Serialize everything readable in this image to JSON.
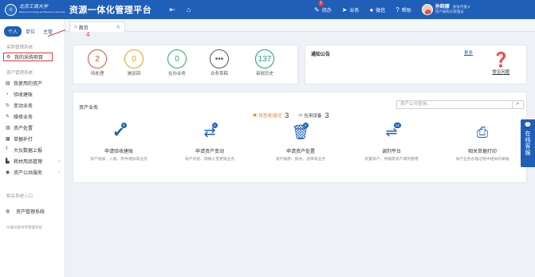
{
  "header": {
    "logo_cn": "北京工商大学",
    "logo_en": "Beijing Technology and Business University",
    "app_title": "资源一体化管理平台",
    "todo_label": "待办",
    "todo_badge": "2",
    "business_label": "业务",
    "wechat_label": "微信",
    "help_label": "帮助",
    "user_name": "孙晓娜",
    "user_role": "资产采购与管理员",
    "user_sub": "身份代理 ▾"
  },
  "sidebar": {
    "tabs": [
      "个人",
      "单位",
      "主管"
    ],
    "sec1_title": "采购管理系统",
    "purchase_item": "我的采购项目",
    "sec2_title": "资产管理系统",
    "items": [
      {
        "icon": "▤",
        "label": "我使用的资产",
        "arrow": ""
      },
      {
        "icon": "◔",
        "label": "验收建账",
        "arrow": ""
      },
      {
        "icon": "↻",
        "label": "变动业务",
        "arrow": ""
      },
      {
        "icon": "✎",
        "label": "维修业务",
        "arrow": ""
      },
      {
        "icon": "▥",
        "label": "资产处置",
        "arrow": ""
      },
      {
        "icon": "▦",
        "label": "单据补打",
        "arrow": ""
      },
      {
        "icon": "⤒",
        "label": "大仪数据上报",
        "arrow": ""
      },
      {
        "icon": "▙",
        "label": "耗材用品管理",
        "arrow": "‹"
      },
      {
        "icon": "◉",
        "label": "资产公共服务",
        "arrow": "‹"
      }
    ],
    "sec3_title": "相关系统入口",
    "asset_system": "资产管理系统",
    "sec4_title": "仪器设备共享管理系统"
  },
  "annotation": "4",
  "tabstrip": {
    "home_tab": "首页",
    "refresh_icon": "refresh-icon"
  },
  "stats": [
    {
      "value": "2",
      "label": "待处理",
      "color": "#e74c3c"
    },
    {
      "value": "0",
      "label": "被驳回",
      "color": "#f39c12"
    },
    {
      "value": "0",
      "label": "在办业务",
      "color": "#27ae60"
    },
    {
      "value": "•••",
      "label": "业务草稿",
      "color": "#555555"
    },
    {
      "value": "137",
      "label": "审批历史",
      "color": "#16a085"
    }
  ],
  "notice": {
    "title": "通知公告",
    "more": "更多",
    "faq": "常见问题"
  },
  "business": {
    "title": "资产业务",
    "search_placeholder": "资产公共查询...",
    "counter1_label": "待签收/退还",
    "counter1_value": "3",
    "counter2_label": "在用设备",
    "counter2_value": "3",
    "items": [
      {
        "icon": "✔",
        "badge": "0",
        "title": "申请验收建账",
        "desc": "资产验收、入账、附件增加等业务"
      },
      {
        "icon": "⇄",
        "badge": "0",
        "title": "申请资产变动",
        "desc": "资产领退、调拨人变更等业务"
      },
      {
        "icon": "🗑",
        "badge": "0",
        "title": "申请资产处置",
        "desc": "资产报废、报失、退库等业务"
      },
      {
        "icon": "⇌",
        "badge": "22",
        "title": "调剂平台",
        "desc": "闲置资产、待报废资产调剂使用"
      },
      {
        "icon": "⎙",
        "badge": "",
        "title": "相关单据打印",
        "desc": "资产业务办理过程中相关的单据"
      }
    ]
  },
  "service": "在线客服",
  "colors": {
    "brand": "#1f5fb8",
    "highlight": "#e53935"
  }
}
